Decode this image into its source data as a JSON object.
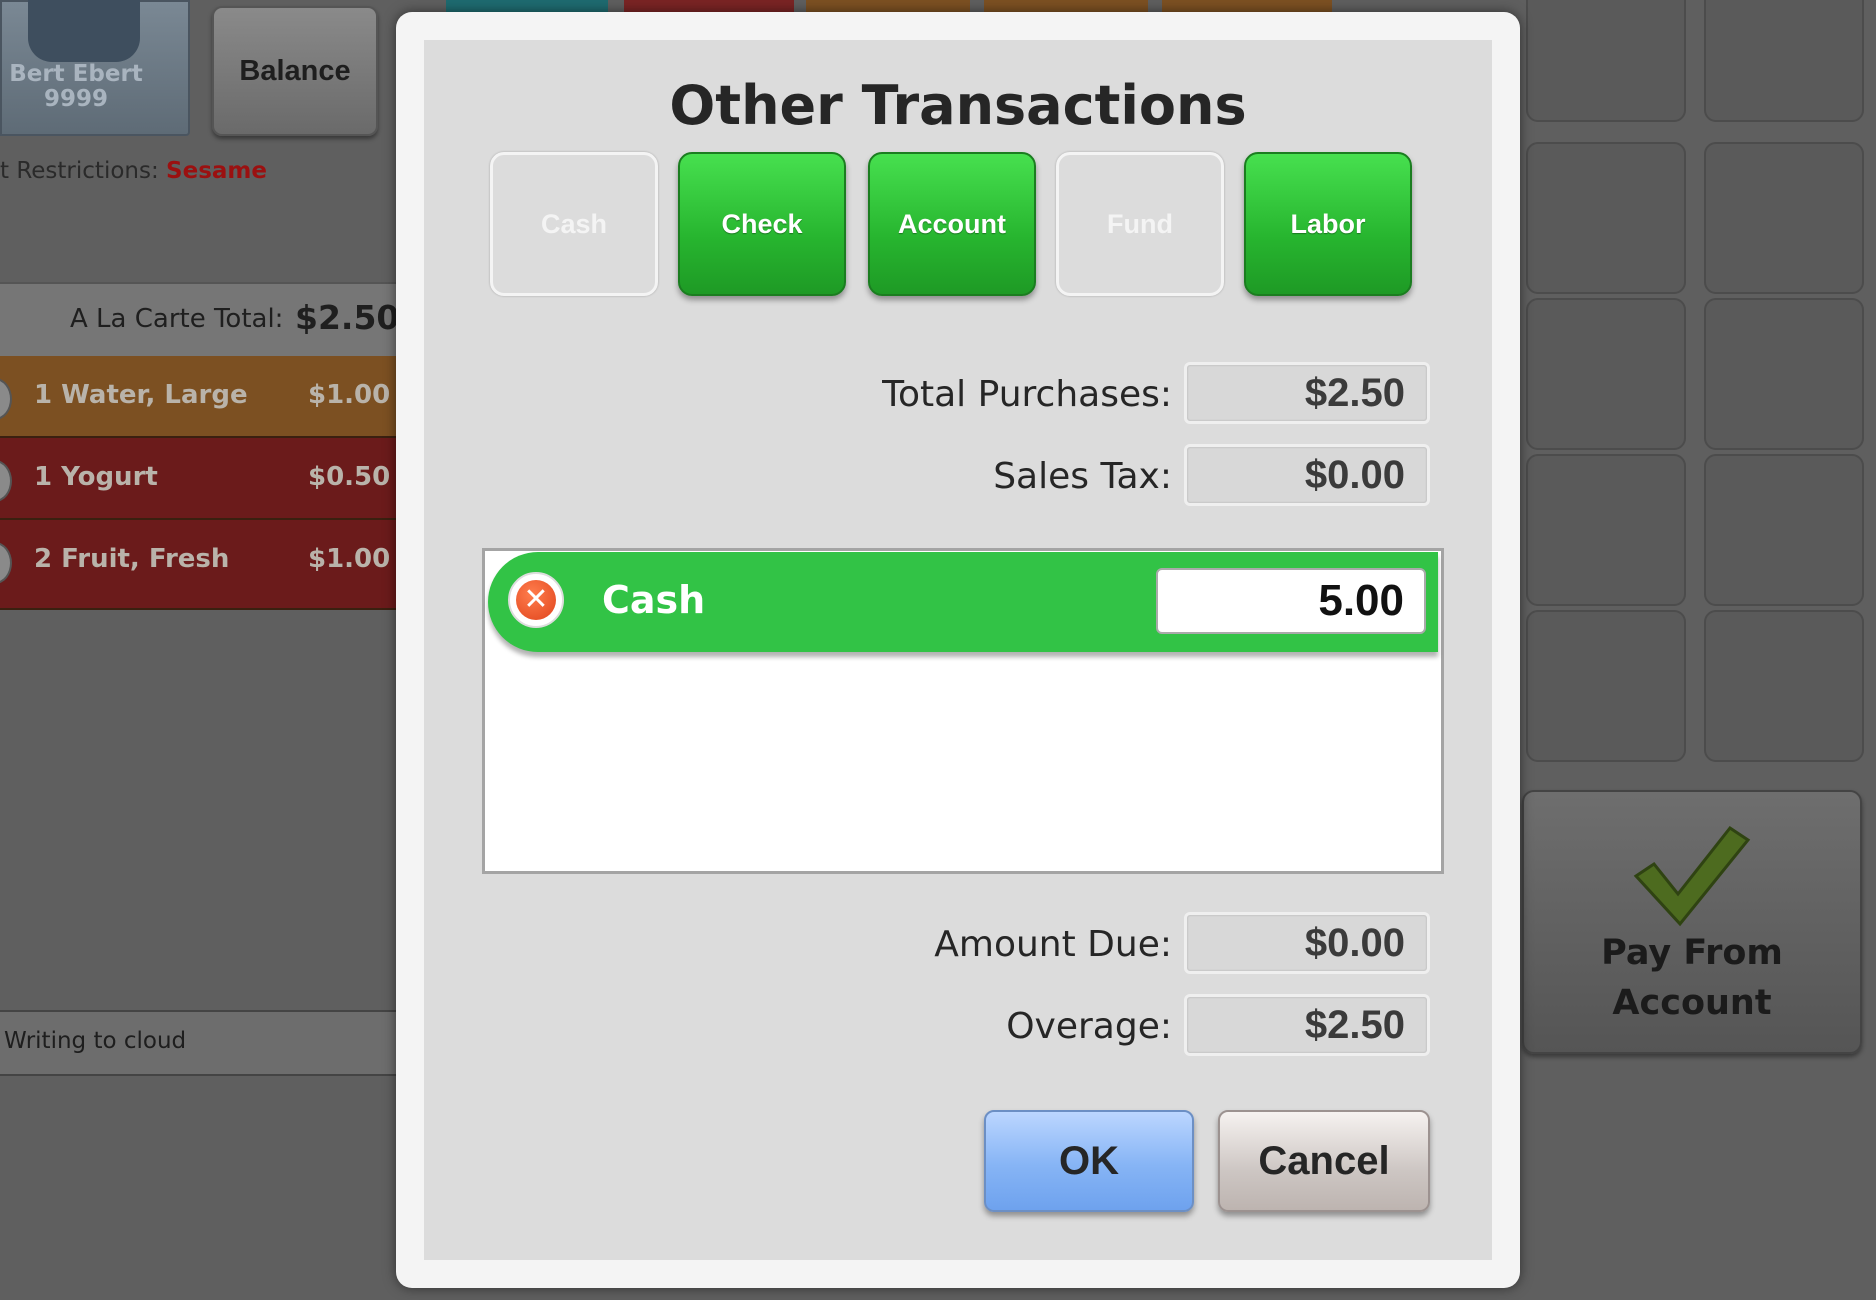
{
  "student": {
    "name": "Bert Ebert",
    "id": "9999"
  },
  "header": {
    "balance_label": "Balance"
  },
  "restrictions": {
    "label": "t Restrictions:",
    "value": "Sesame"
  },
  "order": {
    "total_label": "A La Carte Total:",
    "total_value": "$2.50",
    "items": [
      {
        "label": "1 Water, Large",
        "price": "$1.00"
      },
      {
        "label": "1 Yogurt",
        "price": "$0.50"
      },
      {
        "label": "2 Fruit, Fresh",
        "price": "$1.00"
      }
    ]
  },
  "status": {
    "text": "Writing to cloud"
  },
  "pay_button": {
    "line1": "Pay From",
    "line2": "Account"
  },
  "modal": {
    "title": "Other Transactions",
    "types": [
      {
        "label": "Cash",
        "active": false
      },
      {
        "label": "Check",
        "active": true
      },
      {
        "label": "Account",
        "active": true
      },
      {
        "label": "Fund",
        "active": false
      },
      {
        "label": "Labor",
        "active": true
      }
    ],
    "total_purchases_label": "Total Purchases:",
    "total_purchases_value": "$2.50",
    "sales_tax_label": "Sales Tax:",
    "sales_tax_value": "$0.00",
    "tenders": [
      {
        "type": "Cash",
        "amount": "5.00"
      }
    ],
    "amount_due_label": "Amount Due:",
    "amount_due_value": "$0.00",
    "overage_label": "Overage:",
    "overage_value": "$2.50",
    "ok_label": "OK",
    "cancel_label": "Cancel"
  },
  "colors": {
    "active_green": "#32c346",
    "ok_blue": "#86b4f5",
    "restriction_red": "#9b1010"
  },
  "icons": {
    "remove_tender": "close-circle-icon",
    "pay_check": "checkmark-icon"
  }
}
